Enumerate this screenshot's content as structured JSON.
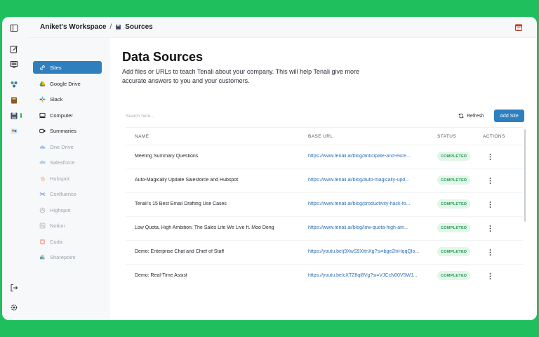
{
  "breadcrumb": {
    "workspace": "Aniket's Workspace",
    "separator": "/",
    "current": "Sources"
  },
  "rail": {
    "icons": [
      "sidebar-toggle-icon",
      "edit-icon",
      "monitor-icon",
      "integrations-icon",
      "book-icon",
      "save-icon",
      "people-icon",
      "logout-icon",
      "settings-icon"
    ]
  },
  "subnav": {
    "items": [
      {
        "label": "Sites",
        "icon": "link-icon",
        "active": true
      },
      {
        "label": "Google Drive",
        "icon": "google-drive-icon",
        "active": false
      },
      {
        "label": "Slack",
        "icon": "slack-icon",
        "active": false
      },
      {
        "label": "Computer",
        "icon": "computer-icon",
        "active": false
      },
      {
        "label": "Summaries",
        "icon": "video-icon",
        "active": false
      },
      {
        "label": "One Drive",
        "icon": "onedrive-icon",
        "active": false
      },
      {
        "label": "Salesforce",
        "icon": "salesforce-icon",
        "active": false
      },
      {
        "label": "Hubspot",
        "icon": "hubspot-icon",
        "active": false
      },
      {
        "label": "Confluence",
        "icon": "confluence-icon",
        "active": false
      },
      {
        "label": "Highspot",
        "icon": "highspot-icon",
        "active": false
      },
      {
        "label": "Notion",
        "icon": "notion-icon",
        "active": false
      },
      {
        "label": "Coda",
        "icon": "coda-icon",
        "active": false
      },
      {
        "label": "Sharepoint",
        "icon": "sharepoint-icon",
        "active": false
      }
    ]
  },
  "main": {
    "title": "Data Sources",
    "description": "Add files or URLs to teach Tenali about your company. This will help Tenali give more accurate answers to you and your customers.",
    "search_placeholder": "Search here...",
    "refresh_label": "Refresh",
    "add_site_label": "Add Site"
  },
  "table": {
    "headers": {
      "name": "NAME",
      "url": "BASE URL",
      "status": "STATUS",
      "actions": "ACTIONS"
    },
    "rows": [
      {
        "name": "Meeting Summary Questions",
        "url": "https://www.tenali.ai/blog/anticipate-and-exce...",
        "status": "COMPLETED"
      },
      {
        "name": "Auto-Magically Update Salesforce and Hubspot",
        "url": "https://www.tenali.ai/blog/auto-magically-upd...",
        "status": "COMPLETED"
      },
      {
        "name": "Tenali's 15 Best Email Drafting Use Cases",
        "url": "https://www.tenali.ai/blog/productivity-hack-fo...",
        "status": "COMPLETED"
      },
      {
        "name": "Low Quota, High Ambition: The Sales Life We Live ft. Moo Deng",
        "url": "https://www.tenali.ai/blog/low-quota-high-am...",
        "status": "COMPLETED"
      },
      {
        "name": "Demo: Enterprise Chat and Chief of Staff",
        "url": "https://youtu.be/j9XwS9XttnXg?si=bge2lnHqqQlo...",
        "status": "COMPLETED"
      },
      {
        "name": "Demo: Real-Time Assist",
        "url": "https://youtu.be/cXTZ8ql8Vg?si=VJCcN00V5WJ...",
        "status": "COMPLETED"
      }
    ]
  },
  "colors": {
    "accent": "#2f7fbf",
    "background": "#1fbf5e",
    "status_bg": "#e3f6ea",
    "status_text": "#1f9a4e",
    "link": "#2f6fb0"
  }
}
